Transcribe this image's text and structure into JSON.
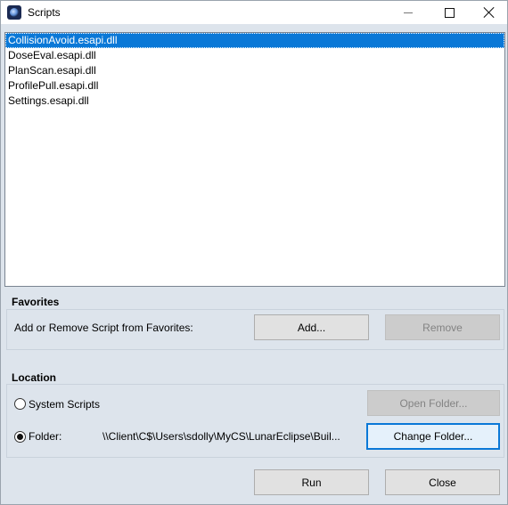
{
  "window": {
    "title": "Scripts"
  },
  "scripts_list": {
    "items": [
      {
        "label": "CollisionAvoid.esapi.dll",
        "selected": true
      },
      {
        "label": "DoseEval.esapi.dll",
        "selected": false
      },
      {
        "label": "PlanScan.esapi.dll",
        "selected": false
      },
      {
        "label": "ProfilePull.esapi.dll",
        "selected": false
      },
      {
        "label": "Settings.esapi.dll",
        "selected": false
      }
    ]
  },
  "favorites": {
    "title": "Favorites",
    "prompt": "Add or Remove Script from Favorites:",
    "add_label": "Add...",
    "remove_label": "Remove"
  },
  "location": {
    "title": "Location",
    "system_scripts_label": "System Scripts",
    "folder_label": "Folder:",
    "folder_path": "\\\\Client\\C$\\Users\\sdolly\\MyCS\\LunarEclipse\\Buil...",
    "open_folder_label": "Open Folder...",
    "change_folder_label": "Change Folder...",
    "selected": "folder"
  },
  "actions": {
    "run_label": "Run",
    "close_label": "Close"
  },
  "colors": {
    "selection": "#0a78d7",
    "dialog_bg": "#dde4ec"
  }
}
